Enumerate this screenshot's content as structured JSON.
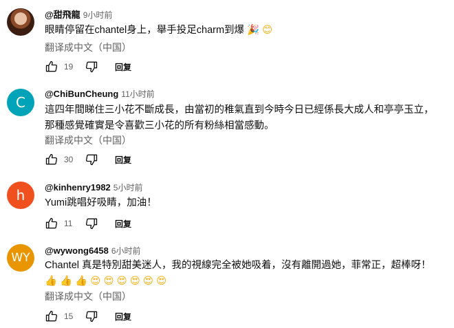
{
  "colors": {
    "avatar_c": "#00a3b8",
    "avatar_h": "#f0501e",
    "avatar_wy": "#e89500"
  },
  "ui": {
    "translate_label": "翻译成中文（中国）",
    "reply_label": "回复"
  },
  "comments": [
    {
      "author": "@甜飛龍",
      "time": "9小时前",
      "text": "眼睛停留在chantel身上，舉手投足charm到爆",
      "emojis": [
        "🎉",
        "😊"
      ],
      "likes": "19"
    },
    {
      "avatar_letter": "C",
      "author": "@ChiBunCheung",
      "time": "11小时前",
      "text": "這四年間睇住三小花不斷成長，由當初的稚氣直到今時今日已經係長大成人和亭亭玉立，那種感覺確實是令喜歡三小花的所有粉絲相當感動。",
      "likes": "30"
    },
    {
      "avatar_letter": "h",
      "author": "@kinhenry1982",
      "time": "5小时前",
      "text": "Yumi跳唱好吸睛，加油！",
      "likes": "11"
    },
    {
      "avatar_letter": "WY",
      "author": "@wywong6458",
      "time": "6小时前",
      "text": "Chantel 真是特別甜美迷人，我的視線完全被她吸着，沒有離開過她，菲常正，超棒呀！",
      "emojis": [
        "👍",
        "👍",
        "👍",
        "😍",
        "😍",
        "😍",
        "😍",
        "😍",
        "😍"
      ],
      "likes": "15"
    }
  ]
}
